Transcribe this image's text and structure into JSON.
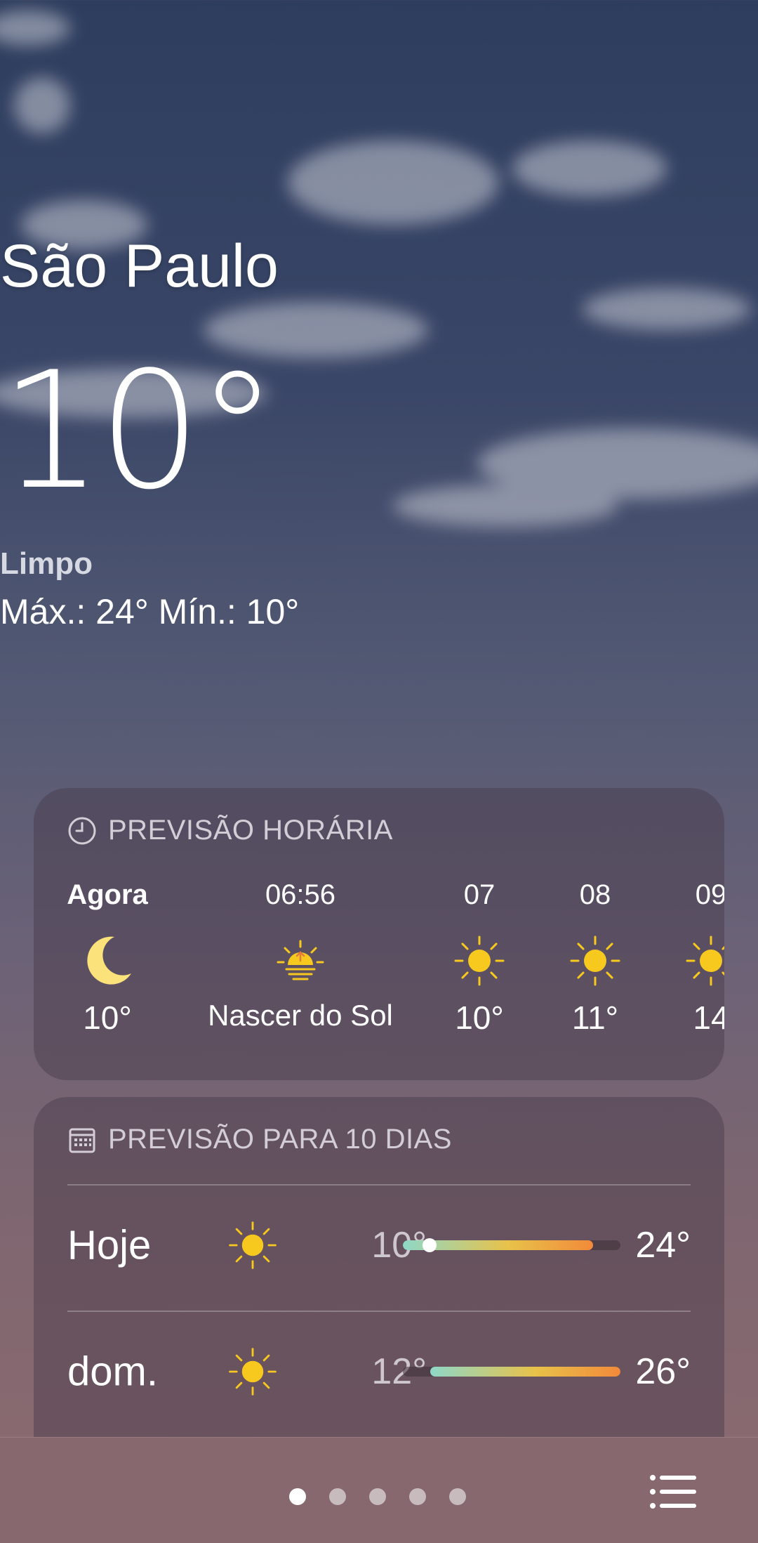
{
  "location": {
    "city": "São Paulo",
    "temperature": "10",
    "degree": "°",
    "condition": "Limpo",
    "high_low": "Máx.: 24°  Mín.: 10°"
  },
  "hourly": {
    "title": "PREVISÃO HORÁRIA",
    "icon": "clock-icon",
    "items": [
      {
        "time": "Agora",
        "icon": "moon-icon",
        "value": "10°"
      },
      {
        "time": "06:56",
        "icon": "sunrise-icon",
        "value": "Nascer do Sol"
      },
      {
        "time": "07",
        "icon": "sun-icon",
        "value": "10°"
      },
      {
        "time": "08",
        "icon": "sun-icon",
        "value": "11°"
      },
      {
        "time": "09",
        "icon": "sun-icon",
        "value": "14"
      }
    ]
  },
  "daily": {
    "title": "PREVISÃO PARA 10 DIAS",
    "icon": "calendar-icon",
    "range_min": 10,
    "range_max": 26,
    "days": [
      {
        "name": "Hoje",
        "icon": "sun-icon",
        "low": "10°",
        "high": "24°",
        "low_value": 10,
        "high_value": 24,
        "current_value": 10
      },
      {
        "name": "dom.",
        "icon": "sun-icon",
        "low": "12°",
        "high": "26°",
        "low_value": 12,
        "high_value": 26
      }
    ]
  },
  "pager": {
    "count": 5,
    "active": 0
  },
  "colors": {
    "sun": "#f7c91e",
    "moon": "#fbe27a",
    "bar_cool": "#8ed8c8",
    "bar_warm": "#f28a3a"
  }
}
